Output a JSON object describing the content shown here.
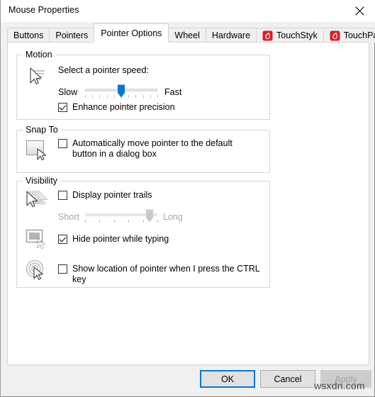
{
  "window": {
    "title": "Mouse Properties",
    "close_icon": "close-icon"
  },
  "tabs": [
    {
      "label": "Buttons",
      "selected": false,
      "icon": null
    },
    {
      "label": "Pointers",
      "selected": false,
      "icon": null
    },
    {
      "label": "Pointer Options",
      "selected": true,
      "icon": null
    },
    {
      "label": "Wheel",
      "selected": false,
      "icon": null
    },
    {
      "label": "Hardware",
      "selected": false,
      "icon": null
    },
    {
      "label": "TouchStyk",
      "selected": false,
      "icon": "touchstyk-red-icon"
    },
    {
      "label": "TouchPad",
      "selected": false,
      "icon": "touchpad-red-icon"
    }
  ],
  "motion": {
    "group_title": "Motion",
    "icon": "pointer-trail-icon",
    "speed_label": "Select a pointer speed:",
    "slider": {
      "min_label": "Slow",
      "max_label": "Fast",
      "value": 6,
      "min": 1,
      "max": 11,
      "tick_count": 11,
      "enabled": true
    },
    "enhance_precision": {
      "label": "Enhance pointer precision",
      "checked": true
    }
  },
  "snap_to": {
    "group_title": "Snap To",
    "icon": "dialog-button-pointer-icon",
    "auto_move": {
      "label": "Automatically move pointer to the default button in a dialog box",
      "checked": false
    }
  },
  "visibility": {
    "group_title": "Visibility",
    "trails": {
      "icon": "pointer-trails-icon",
      "label": "Display pointer trails",
      "checked": false,
      "slider": {
        "min_label": "Short",
        "max_label": "Long",
        "value": 9,
        "min": 1,
        "max": 10,
        "tick_count": 6,
        "enabled": false
      }
    },
    "hide_typing": {
      "icon": "hide-pointer-typing-icon",
      "label": "Hide pointer while typing",
      "checked": true
    },
    "show_location": {
      "icon": "ctrl-locate-pointer-icon",
      "label": "Show location of pointer when I press the CTRL key",
      "checked": false
    }
  },
  "buttons": {
    "ok": "OK",
    "cancel": "Cancel",
    "apply": "Apply",
    "apply_enabled": false
  },
  "watermark": "wsxdn.com",
  "colors": {
    "accent": "#0078d7",
    "slider_thumb": "#0078d7",
    "tab_icon_red": "#e01b24",
    "disabled_text": "#a6a6a6",
    "window_bg": "#f0f0f0",
    "page_bg": "#ffffff"
  }
}
